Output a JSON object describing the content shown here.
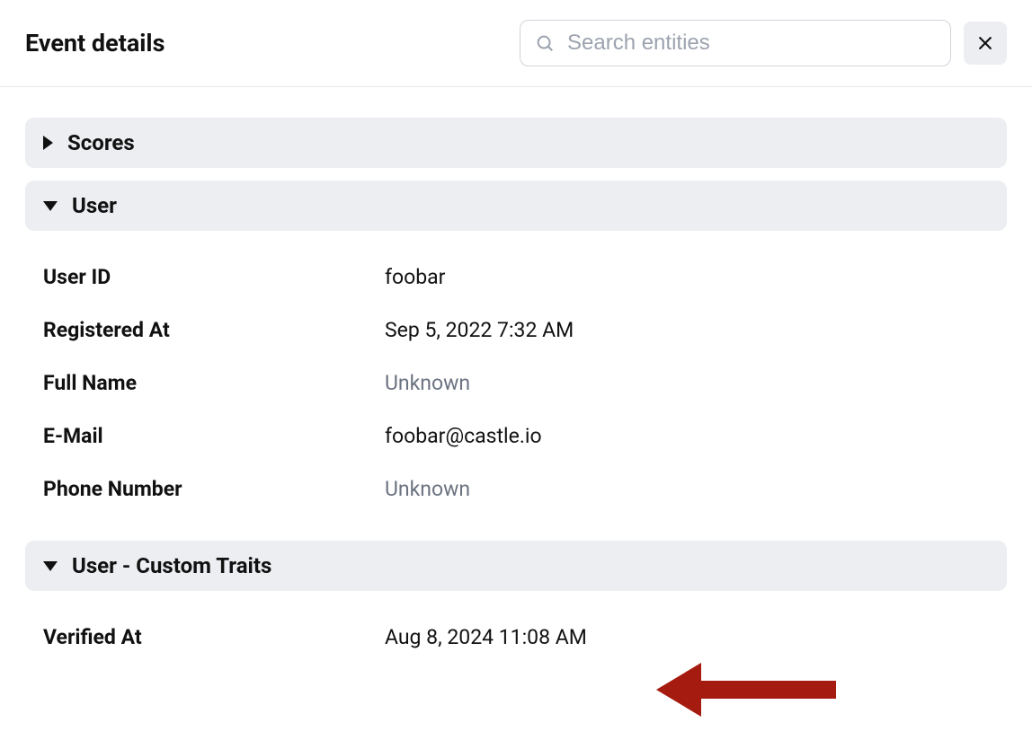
{
  "header": {
    "title": "Event details",
    "search_placeholder": "Search entities"
  },
  "sections": {
    "scores": {
      "title": "Scores",
      "expanded": false
    },
    "user": {
      "title": "User",
      "expanded": true,
      "fields": {
        "user_id": {
          "label": "User ID",
          "value": "foobar",
          "unknown": false
        },
        "registered_at": {
          "label": "Registered At",
          "value": "Sep 5, 2022 7:32 AM",
          "unknown": false
        },
        "full_name": {
          "label": "Full Name",
          "value": "Unknown",
          "unknown": true
        },
        "email": {
          "label": "E-Mail",
          "value": "foobar@castle.io",
          "unknown": false
        },
        "phone": {
          "label": "Phone Number",
          "value": "Unknown",
          "unknown": true
        }
      }
    },
    "custom_traits": {
      "title": "User - Custom Traits",
      "expanded": true,
      "fields": {
        "verified_at": {
          "label": "Verified At",
          "value": "Aug 8, 2024 11:08 AM",
          "unknown": false
        }
      }
    }
  }
}
